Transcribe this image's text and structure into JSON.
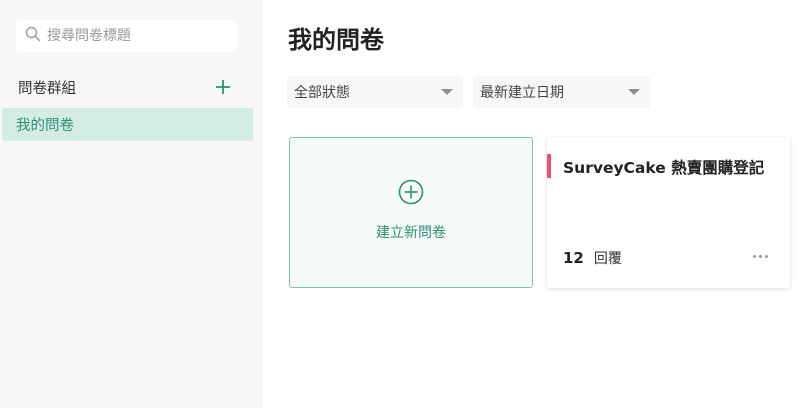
{
  "sidebar": {
    "search": {
      "placeholder": "搜尋問卷標題",
      "value": ""
    },
    "group_title": "問卷群組",
    "nav_items": [
      {
        "label": "我的問卷",
        "active": true
      }
    ]
  },
  "main": {
    "title": "我的問卷",
    "filters": {
      "status": {
        "selected": "全部狀態"
      },
      "sort": {
        "selected": "最新建立日期"
      }
    },
    "new_survey_label": "建立新問卷",
    "surveys": [
      {
        "title": "SurveyCake 熱賣團購登記",
        "response_count": "12",
        "response_label": "回覆",
        "accent_color": "#ef4f73"
      }
    ]
  },
  "colors": {
    "brand": "#2f8f73",
    "active_nav_bg": "#d3ece5",
    "new_card_border": "#7cc5ae",
    "accent": "#ef4f73"
  },
  "icons": [
    "search-icon",
    "plus-icon",
    "chevron-down-icon",
    "add-circle-icon",
    "more-icon"
  ]
}
